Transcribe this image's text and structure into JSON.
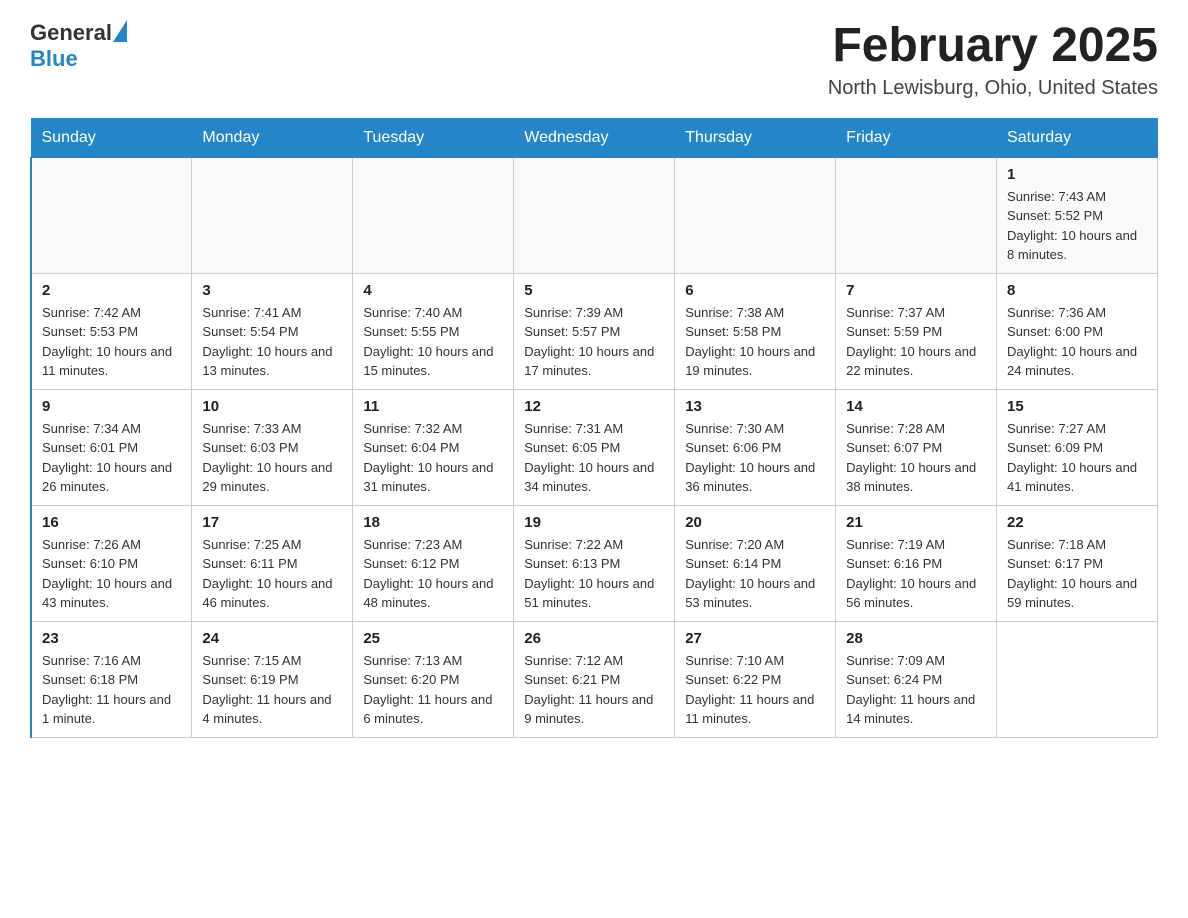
{
  "header": {
    "logo_general": "General",
    "logo_blue": "Blue",
    "month_title": "February 2025",
    "location": "North Lewisburg, Ohio, United States"
  },
  "weekdays": [
    "Sunday",
    "Monday",
    "Tuesday",
    "Wednesday",
    "Thursday",
    "Friday",
    "Saturday"
  ],
  "weeks": [
    [
      {
        "day": "",
        "info": ""
      },
      {
        "day": "",
        "info": ""
      },
      {
        "day": "",
        "info": ""
      },
      {
        "day": "",
        "info": ""
      },
      {
        "day": "",
        "info": ""
      },
      {
        "day": "",
        "info": ""
      },
      {
        "day": "1",
        "info": "Sunrise: 7:43 AM\nSunset: 5:52 PM\nDaylight: 10 hours and 8 minutes."
      }
    ],
    [
      {
        "day": "2",
        "info": "Sunrise: 7:42 AM\nSunset: 5:53 PM\nDaylight: 10 hours and 11 minutes."
      },
      {
        "day": "3",
        "info": "Sunrise: 7:41 AM\nSunset: 5:54 PM\nDaylight: 10 hours and 13 minutes."
      },
      {
        "day": "4",
        "info": "Sunrise: 7:40 AM\nSunset: 5:55 PM\nDaylight: 10 hours and 15 minutes."
      },
      {
        "day": "5",
        "info": "Sunrise: 7:39 AM\nSunset: 5:57 PM\nDaylight: 10 hours and 17 minutes."
      },
      {
        "day": "6",
        "info": "Sunrise: 7:38 AM\nSunset: 5:58 PM\nDaylight: 10 hours and 19 minutes."
      },
      {
        "day": "7",
        "info": "Sunrise: 7:37 AM\nSunset: 5:59 PM\nDaylight: 10 hours and 22 minutes."
      },
      {
        "day": "8",
        "info": "Sunrise: 7:36 AM\nSunset: 6:00 PM\nDaylight: 10 hours and 24 minutes."
      }
    ],
    [
      {
        "day": "9",
        "info": "Sunrise: 7:34 AM\nSunset: 6:01 PM\nDaylight: 10 hours and 26 minutes."
      },
      {
        "day": "10",
        "info": "Sunrise: 7:33 AM\nSunset: 6:03 PM\nDaylight: 10 hours and 29 minutes."
      },
      {
        "day": "11",
        "info": "Sunrise: 7:32 AM\nSunset: 6:04 PM\nDaylight: 10 hours and 31 minutes."
      },
      {
        "day": "12",
        "info": "Sunrise: 7:31 AM\nSunset: 6:05 PM\nDaylight: 10 hours and 34 minutes."
      },
      {
        "day": "13",
        "info": "Sunrise: 7:30 AM\nSunset: 6:06 PM\nDaylight: 10 hours and 36 minutes."
      },
      {
        "day": "14",
        "info": "Sunrise: 7:28 AM\nSunset: 6:07 PM\nDaylight: 10 hours and 38 minutes."
      },
      {
        "day": "15",
        "info": "Sunrise: 7:27 AM\nSunset: 6:09 PM\nDaylight: 10 hours and 41 minutes."
      }
    ],
    [
      {
        "day": "16",
        "info": "Sunrise: 7:26 AM\nSunset: 6:10 PM\nDaylight: 10 hours and 43 minutes."
      },
      {
        "day": "17",
        "info": "Sunrise: 7:25 AM\nSunset: 6:11 PM\nDaylight: 10 hours and 46 minutes."
      },
      {
        "day": "18",
        "info": "Sunrise: 7:23 AM\nSunset: 6:12 PM\nDaylight: 10 hours and 48 minutes."
      },
      {
        "day": "19",
        "info": "Sunrise: 7:22 AM\nSunset: 6:13 PM\nDaylight: 10 hours and 51 minutes."
      },
      {
        "day": "20",
        "info": "Sunrise: 7:20 AM\nSunset: 6:14 PM\nDaylight: 10 hours and 53 minutes."
      },
      {
        "day": "21",
        "info": "Sunrise: 7:19 AM\nSunset: 6:16 PM\nDaylight: 10 hours and 56 minutes."
      },
      {
        "day": "22",
        "info": "Sunrise: 7:18 AM\nSunset: 6:17 PM\nDaylight: 10 hours and 59 minutes."
      }
    ],
    [
      {
        "day": "23",
        "info": "Sunrise: 7:16 AM\nSunset: 6:18 PM\nDaylight: 11 hours and 1 minute."
      },
      {
        "day": "24",
        "info": "Sunrise: 7:15 AM\nSunset: 6:19 PM\nDaylight: 11 hours and 4 minutes."
      },
      {
        "day": "25",
        "info": "Sunrise: 7:13 AM\nSunset: 6:20 PM\nDaylight: 11 hours and 6 minutes."
      },
      {
        "day": "26",
        "info": "Sunrise: 7:12 AM\nSunset: 6:21 PM\nDaylight: 11 hours and 9 minutes."
      },
      {
        "day": "27",
        "info": "Sunrise: 7:10 AM\nSunset: 6:22 PM\nDaylight: 11 hours and 11 minutes."
      },
      {
        "day": "28",
        "info": "Sunrise: 7:09 AM\nSunset: 6:24 PM\nDaylight: 11 hours and 14 minutes."
      },
      {
        "day": "",
        "info": ""
      }
    ]
  ]
}
